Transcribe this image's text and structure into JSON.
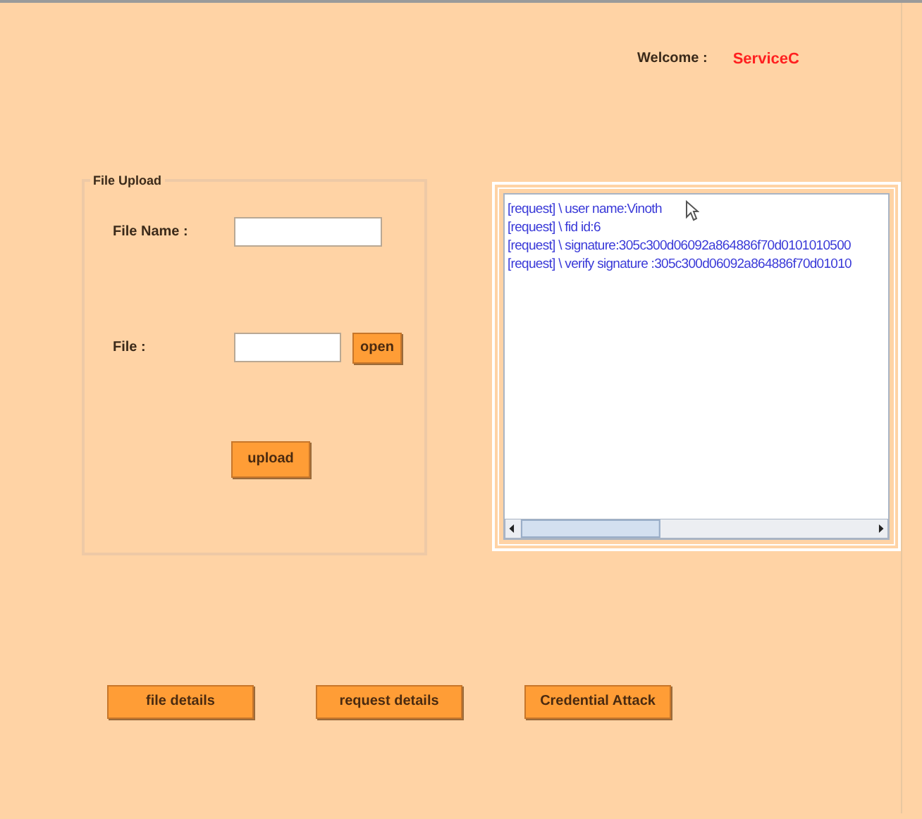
{
  "header": {
    "welcome_label": "Welcome :",
    "user": "ServiceC"
  },
  "file_upload": {
    "title": "File Upload",
    "file_name_label": "File Name :",
    "file_label": "File :",
    "open_button": "open",
    "upload_button": "upload"
  },
  "log": {
    "lines": [
      "[request]  \\ user name:Vinoth",
      "[request]  \\ fid id:6",
      "[request]  \\ signature:305c300d06092a864886f70d0101010500",
      "[request]  \\ verify signature :305c300d06092a864886f70d01010"
    ]
  },
  "buttons": [
    "file details",
    "request details",
    "Credential Attack"
  ]
}
